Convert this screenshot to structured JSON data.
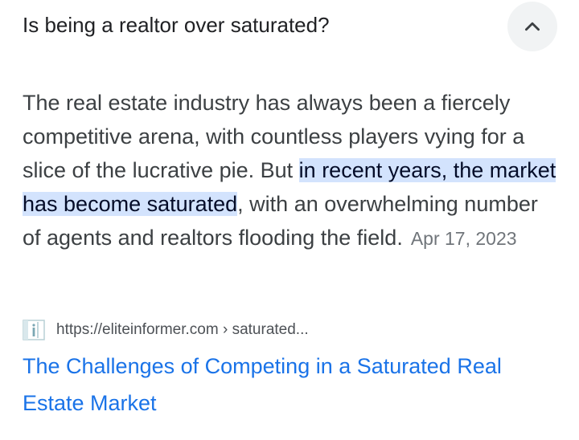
{
  "question": "Is being a realtor over saturated?",
  "collapse_icon": "chevron-up-icon",
  "snippet": {
    "text_before": "The real estate industry has always been a fiercely competitive arena, with countless players vying for a slice of the lucrative pie. But ",
    "highlight": "in recent years, the market has become saturated",
    "text_after": ", with an overwhelming number of agents and realtors flooding the field.",
    "date": "Apr 17, 2023"
  },
  "source": {
    "favicon": "info-image-icon",
    "url": "https://eliteinformer.com › saturated..."
  },
  "result": {
    "title": "The Challenges of Competing in a Saturated Real Estate Market"
  },
  "colors": {
    "highlight_bg": "#d3e3fd",
    "link": "#1a73e8",
    "button_bg": "#f1f3f4"
  }
}
